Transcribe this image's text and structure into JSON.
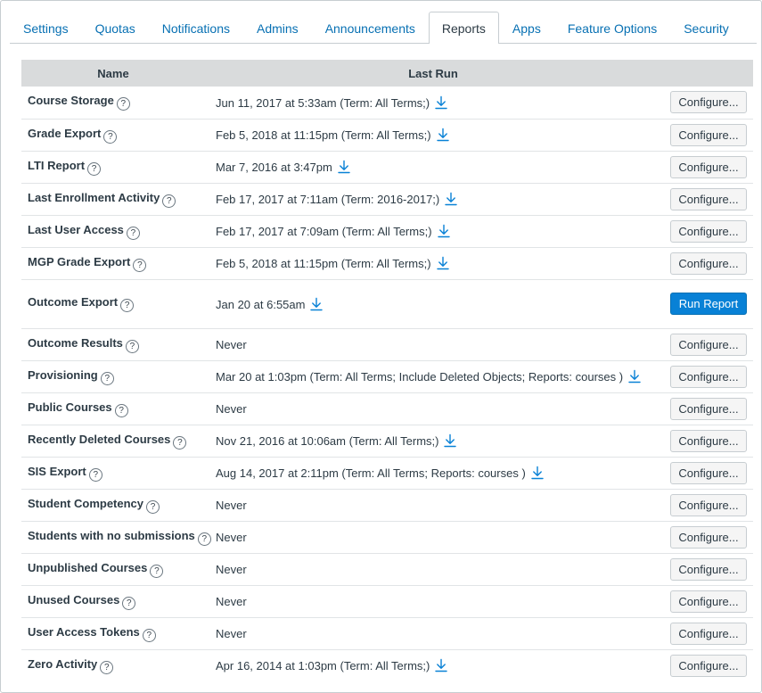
{
  "tabs": [
    {
      "label": "Settings",
      "active": false
    },
    {
      "label": "Quotas",
      "active": false
    },
    {
      "label": "Notifications",
      "active": false
    },
    {
      "label": "Admins",
      "active": false
    },
    {
      "label": "Announcements",
      "active": false
    },
    {
      "label": "Reports",
      "active": true
    },
    {
      "label": "Apps",
      "active": false
    },
    {
      "label": "Feature Options",
      "active": false
    },
    {
      "label": "Security",
      "active": false
    }
  ],
  "table": {
    "headers": {
      "name": "Name",
      "last_run": "Last Run"
    },
    "help_glyph": "?",
    "rows": [
      {
        "name": "Course Storage",
        "last_run": "Jun 11, 2017 at 5:33am (Term: All Terms;)",
        "download": true,
        "action": "Configure..."
      },
      {
        "name": "Grade Export",
        "last_run": "Feb 5, 2018 at 11:15pm (Term: All Terms;)",
        "download": true,
        "action": "Configure..."
      },
      {
        "name": "LTI Report",
        "last_run": "Mar 7, 2016 at 3:47pm",
        "download": true,
        "action": "Configure..."
      },
      {
        "name": "Last Enrollment Activity",
        "last_run": "Feb 17, 2017 at 7:11am (Term: 2016-2017;)",
        "download": true,
        "action": "Configure..."
      },
      {
        "name": "Last User Access",
        "last_run": "Feb 17, 2017 at 7:09am (Term: All Terms;)",
        "download": true,
        "action": "Configure..."
      },
      {
        "name": "MGP Grade Export",
        "last_run": "Feb 5, 2018 at 11:15pm (Term: All Terms;)",
        "download": true,
        "action": "Configure..."
      },
      {
        "name": "Outcome Export",
        "last_run": "Jan 20 at 6:55am",
        "download": true,
        "action": "Run Report",
        "primary": true
      },
      {
        "name": "Outcome Results",
        "last_run": "Never",
        "download": false,
        "action": "Configure..."
      },
      {
        "name": "Provisioning",
        "last_run": "Mar 20 at 1:03pm (Term: All Terms; Include Deleted Objects; Reports: courses )",
        "download": true,
        "action": "Configure..."
      },
      {
        "name": "Public Courses",
        "last_run": "Never",
        "download": false,
        "action": "Configure..."
      },
      {
        "name": "Recently Deleted Courses",
        "last_run": "Nov 21, 2016 at 10:06am (Term: All Terms;)",
        "download": true,
        "action": "Configure..."
      },
      {
        "name": "SIS Export",
        "last_run": "Aug 14, 2017 at 2:11pm (Term: All Terms; Reports: courses )",
        "download": true,
        "action": "Configure..."
      },
      {
        "name": "Student Competency",
        "last_run": "Never",
        "download": false,
        "action": "Configure..."
      },
      {
        "name": "Students with no submissions",
        "last_run": "Never",
        "download": false,
        "action": "Configure..."
      },
      {
        "name": "Unpublished Courses",
        "last_run": "Never",
        "download": false,
        "action": "Configure..."
      },
      {
        "name": "Unused Courses",
        "last_run": "Never",
        "download": false,
        "action": "Configure..."
      },
      {
        "name": "User Access Tokens",
        "last_run": "Never",
        "download": false,
        "action": "Configure..."
      },
      {
        "name": "Zero Activity",
        "last_run": "Apr 16, 2014 at 1:03pm (Term: All Terms;)",
        "download": true,
        "action": "Configure..."
      }
    ]
  },
  "colors": {
    "link": "#0770b3",
    "primary_button": "#0881d6",
    "header_bg": "#d9dbdc",
    "text": "#2d3b45"
  },
  "icons": {
    "help": "question-circle-icon",
    "download": "download-icon"
  }
}
